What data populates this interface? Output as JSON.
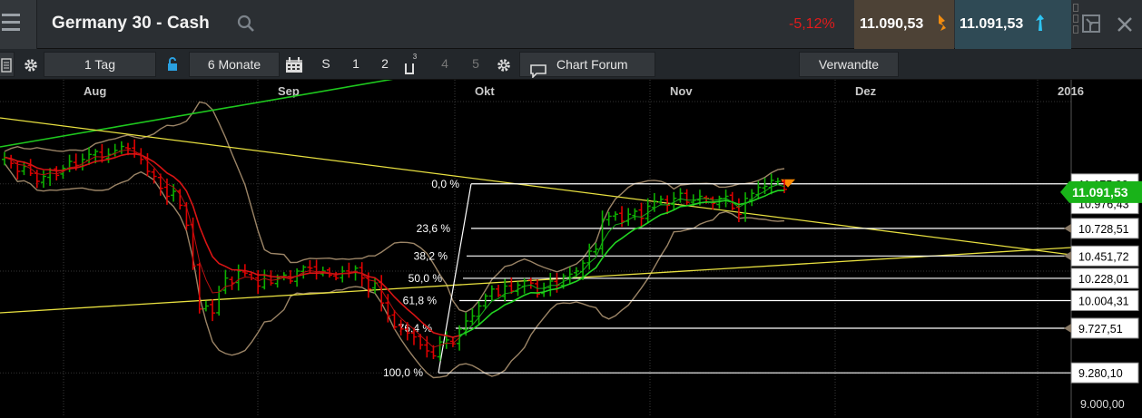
{
  "window": {
    "title": "Germany 30 - Cash",
    "change_pct": "-5,12%",
    "sell_price": "11.090,53",
    "buy_price": "11.091,53",
    "colors": {
      "negative": "#e21b1b",
      "sell_bg": "#4d4236",
      "buy_bg": "#2f4a55",
      "sell_arrow": "#f28c0f",
      "buy_arrow": "#2ec4f2"
    }
  },
  "toolbar": {
    "interval": "1 Tag",
    "range": "6 Monate",
    "btn_s": "S",
    "btn_1": "1",
    "btn_2": "2",
    "btn_3": "3",
    "btn_4": "4",
    "btn_5": "5",
    "forum": "Chart Forum",
    "related": "Verwandte"
  },
  "chart_data": {
    "type": "candlestick",
    "instrument": "Germany 30 - Cash",
    "x_months": [
      "Aug",
      "Sep",
      "Okt",
      "Nov",
      "Dez",
      "2016"
    ],
    "y_range": [
      8900,
      12100
    ],
    "current_price": "11.091,53",
    "price_tags": [
      "11.175,00",
      "10.976,43"
    ],
    "axis_label": "9.000,00",
    "fibonacci": [
      {
        "pct": "0,0 %",
        "value": "11.175,00",
        "price": 11175
      },
      {
        "pct": "23,6 %",
        "value": "10.728,51",
        "price": 10728.51
      },
      {
        "pct": "38,2 %",
        "value": "10.451,72",
        "price": 10451.72
      },
      {
        "pct": "50,0 %",
        "value": "10.228,01",
        "price": 10228.01
      },
      {
        "pct": "61,8 %",
        "value": "10.004,31",
        "price": 10004.31
      },
      {
        "pct": "76,4 %",
        "value": "9.727,51",
        "price": 9727.51
      },
      {
        "pct": "100,0 %",
        "value": "9.280,10",
        "price": 9280.1
      }
    ],
    "series": [
      {
        "name": "",
        "close": [
          11440,
          11380,
          11300,
          11350,
          11280,
          11200,
          11250,
          11310,
          11260,
          11330,
          11400,
          11360,
          11420,
          11470,
          11500,
          11440,
          11470,
          11510,
          11550,
          11530,
          11480,
          11420,
          11300,
          11250,
          11130,
          11050,
          11100,
          10960,
          10760,
          10350,
          9920,
          9950,
          9880,
          10100,
          10230,
          10180,
          10300,
          10280,
          10230,
          10150,
          10260,
          10180,
          10230,
          10260,
          10200,
          10300,
          10340,
          10330,
          10280,
          10300,
          10260,
          10230,
          10300,
          10290,
          10330,
          10230,
          10120,
          10180,
          9980,
          9850,
          9740,
          9720,
          9680,
          9640,
          9560,
          9500,
          9450,
          9590,
          9610,
          9570,
          9720,
          9800,
          9850,
          9950,
          10050,
          10120,
          10060,
          10150,
          10100,
          10160,
          10200,
          10180,
          10070,
          10130,
          10200,
          10160,
          10250,
          10270,
          10300,
          10380,
          10500,
          10520,
          10820,
          10850,
          10870,
          10800,
          10870,
          10900,
          10830,
          10950,
          11000,
          11020,
          10960,
          11030,
          11080,
          10990,
          11010,
          11050,
          11030,
          10980,
          11030,
          11050,
          10930,
          10870,
          11030,
          11080,
          11140,
          11150,
          11210,
          11200,
          11120
        ]
      }
    ],
    "colors": {
      "up": "#0db000",
      "down": "#e00000",
      "ema_fast": "#22d422",
      "ema_slow": "#d81414",
      "bollinger": "#9b8466",
      "trend_green": "#1ec81e",
      "trend_yellow": "#e8e040",
      "fib": "#ffffff",
      "marker": "#ff8a00"
    }
  }
}
